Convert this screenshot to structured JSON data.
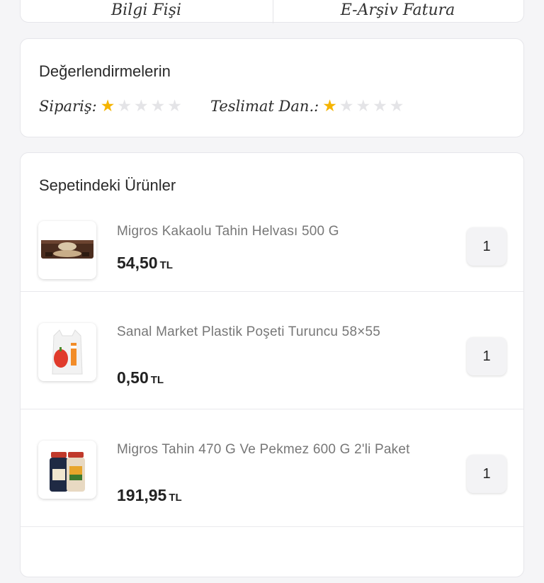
{
  "top_card": {
    "left_label": "Bilgi Fişi",
    "right_label": "E-Arşiv Fatura"
  },
  "ratings": {
    "title": "Değerlendirmelerin",
    "order": {
      "label": "Sipariş:",
      "stars": 1,
      "max": 5
    },
    "delivery": {
      "label": "Teslimat Dan.:",
      "stars": 1,
      "max": 5
    },
    "colors": {
      "filled": "#f5b400",
      "empty": "#e4e4e7"
    }
  },
  "basket": {
    "title": "Sepetindeki Ürünler",
    "items": [
      {
        "name": "Migros Kakaolu Tahin Helvası 500 G",
        "price": "54,50",
        "currency": "TL",
        "quantity": "1",
        "image": "helva-package"
      },
      {
        "name": "Sanal Market Plastik Poşeti Turuncu 58×55",
        "price": "0,50",
        "currency": "TL",
        "quantity": "1",
        "image": "plastic-bag"
      },
      {
        "name": "Migros Tahin 470 G Ve Pekmez 600 G 2'li Paket",
        "price": "191,95",
        "currency": "TL",
        "quantity": "1",
        "image": "tahin-pekmez-bottles"
      }
    ]
  }
}
